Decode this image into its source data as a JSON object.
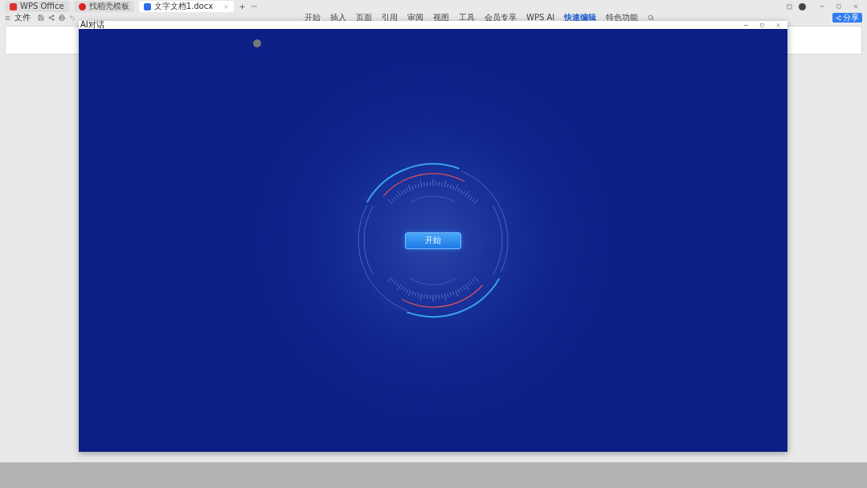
{
  "app_tabs": [
    {
      "label": "WPS Office",
      "kind": "home",
      "selected": false
    },
    {
      "label": "找稻壳模板",
      "kind": "docer",
      "selected": false
    },
    {
      "label": "文字文档1.docx",
      "kind": "doc",
      "selected": true
    }
  ],
  "toolbar": {
    "file_menu": "文件"
  },
  "ribbon": [
    {
      "label": "开始",
      "selected": false
    },
    {
      "label": "插入",
      "selected": false
    },
    {
      "label": "页面",
      "selected": false
    },
    {
      "label": "引用",
      "selected": false
    },
    {
      "label": "审阅",
      "selected": false
    },
    {
      "label": "视图",
      "selected": false
    },
    {
      "label": "工具",
      "selected": false
    },
    {
      "label": "会员专享",
      "selected": false
    },
    {
      "label": "WPS AI",
      "selected": false
    },
    {
      "label": "快速编辑",
      "selected": true
    },
    {
      "label": "特色功能",
      "selected": false
    }
  ],
  "share_button": "分享",
  "dialog": {
    "title": "AI对话",
    "start_button": "开始"
  }
}
